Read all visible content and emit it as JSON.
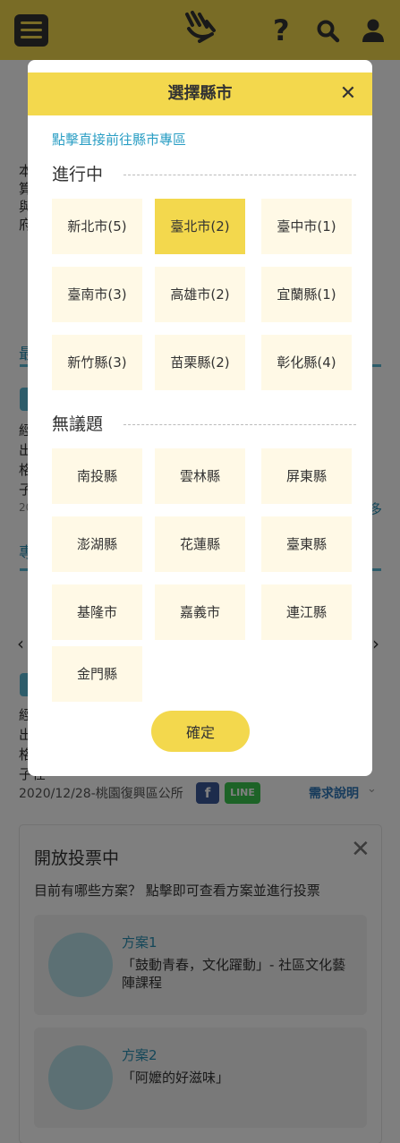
{
  "colors": {
    "brand_yellow": "#f3d84d",
    "chip_bg": "#fff9e6",
    "link_blue": "#2a9ec4",
    "accent_blue": "#5bb8d4"
  },
  "topbar": {
    "icons": [
      "menu-icon",
      "logo-hands-icon",
      "help-icon",
      "search-icon",
      "user-icon"
    ],
    "help_glyph": "?"
  },
  "background": {
    "intro_lines": [
      "本",
      "算",
      "與",
      "府"
    ],
    "section_marker_1": "最",
    "section_marker_2": "專",
    "body_lines": [
      "經",
      "出",
      "格",
      "子"
    ],
    "year_fragment": "20",
    "more_fragment": "多",
    "body_lines_2": [
      "經",
      "出",
      "格",
      "子在"
    ],
    "meta": "2020/12/28-桃園復興區公所",
    "fb_label": "f",
    "line_label": "LINE",
    "need_link": "需求說明"
  },
  "vote": {
    "title": "開放投票中",
    "close_glyph": "✕",
    "subtitle": "目前有哪些方案？ 點擊即可查看方案並進行投票",
    "plans": [
      {
        "label": "方案1",
        "name": "「鼓動青春，文化躍動」- 社區文化藝陣課程"
      },
      {
        "label": "方案2",
        "name": "「阿嬤的好滋味」"
      }
    ]
  },
  "modal": {
    "title": "選擇縣市",
    "close_glyph": "✕",
    "hint": "點擊直接前往縣市專區",
    "active_section": {
      "heading": "進行中",
      "cities": [
        {
          "label": "新北市(5)",
          "selected": false
        },
        {
          "label": "臺北市(2)",
          "selected": true
        },
        {
          "label": "臺中市(1)",
          "selected": false
        },
        {
          "label": "臺南市(3)",
          "selected": false
        },
        {
          "label": "高雄市(2)",
          "selected": false
        },
        {
          "label": "宜蘭縣(1)",
          "selected": false
        },
        {
          "label": "新竹縣(3)",
          "selected": false
        },
        {
          "label": "苗栗縣(2)",
          "selected": false
        },
        {
          "label": "彰化縣(4)",
          "selected": false
        }
      ]
    },
    "empty_section": {
      "heading": "無議題",
      "cities": [
        {
          "label": "南投縣"
        },
        {
          "label": "雲林縣"
        },
        {
          "label": "屏東縣"
        },
        {
          "label": "澎湖縣"
        },
        {
          "label": "花蓮縣"
        },
        {
          "label": "臺東縣"
        },
        {
          "label": "基隆市"
        },
        {
          "label": "嘉義市"
        },
        {
          "label": "連江縣"
        },
        {
          "label": "金門縣"
        }
      ]
    },
    "confirm_label": "確定"
  }
}
